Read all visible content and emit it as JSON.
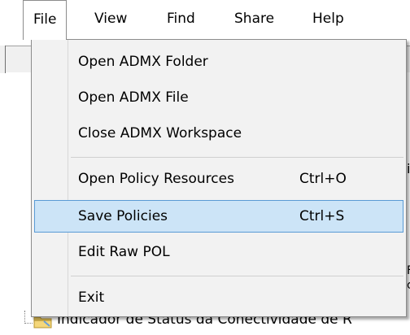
{
  "menubar": {
    "items": [
      {
        "label": "File"
      },
      {
        "label": "View"
      },
      {
        "label": "Find"
      },
      {
        "label": "Share"
      },
      {
        "label": "Help"
      }
    ]
  },
  "file_menu": {
    "items": [
      {
        "label": "Open ADMX Folder",
        "shortcut": ""
      },
      {
        "label": "Open ADMX File",
        "shortcut": ""
      },
      {
        "label": "Close ADMX Workspace",
        "shortcut": ""
      },
      {
        "label": "Open Policy Resources",
        "shortcut": "Ctrl+O"
      },
      {
        "label": "Save Policies",
        "shortcut": "Ctrl+S",
        "highlighted": true
      },
      {
        "label": "Edit Raw POL",
        "shortcut": ""
      },
      {
        "label": "Exit",
        "shortcut": ""
      }
    ]
  },
  "tree": {
    "node_label": "Indicador de Status da Conectividade de R"
  },
  "colors": {
    "highlight_fill": "#cce4f7",
    "highlight_border": "#5a9bd5",
    "menu_bg": "#f2f2f2"
  }
}
